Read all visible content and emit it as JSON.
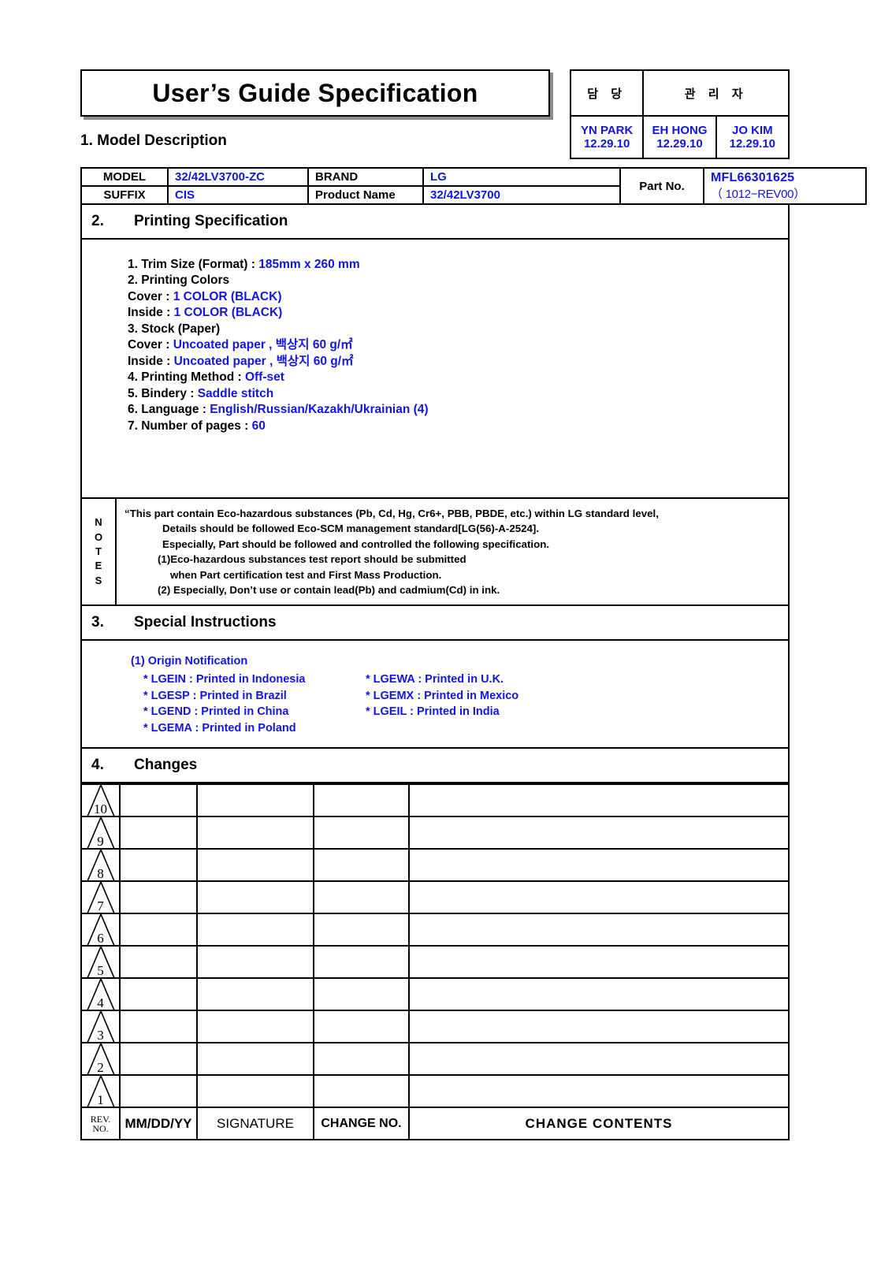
{
  "document": {
    "title": "User’s Guide Specification"
  },
  "approval": {
    "headers": [
      {
        "label": "담  당"
      },
      {
        "label": "관 리 자"
      }
    ],
    "signers": [
      {
        "name": "YN PARK",
        "date": "12.29.10"
      },
      {
        "name": "EH HONG",
        "date": "12.29.10"
      },
      {
        "name": "JO KIM",
        "date": "12.29.10"
      }
    ]
  },
  "section1": {
    "number": "1.",
    "title": "Model Description",
    "heading": "1. Model Description",
    "fields": {
      "model_label": "MODEL",
      "model_value": "32/42LV3700-ZC",
      "brand_label": "BRAND",
      "brand_value": "LG",
      "suffix_label": "SUFFIX",
      "suffix_value": "CIS",
      "product_name_label": "Product Name",
      "product_name_value": "32/42LV3700",
      "part_no_label": "Part No.",
      "part_no_value": "MFL66301625",
      "part_no_revision": "（ 1012−REV00）"
    }
  },
  "section2": {
    "number": "2.",
    "title": "Printing Specification",
    "items": [
      {
        "key": "1. Trim Size (Format) : ",
        "value": "185mm x 260 mm"
      },
      {
        "key": "2. Printing Colors",
        "value": ""
      },
      {
        "key": " Cover : ",
        "value": "1 COLOR (BLACK)"
      },
      {
        "key": " Inside : ",
        "value": "1 COLOR (BLACK)"
      },
      {
        "key": "3. Stock (Paper)",
        "value": ""
      },
      {
        "key": " Cover : ",
        "value": "Uncoated paper , 백상지 60 g/㎡"
      },
      {
        "key": " Inside : ",
        "value": "Uncoated paper , 백상지 60 g/㎡"
      },
      {
        "key": "4. Printing Method : ",
        "value": "Off-set"
      },
      {
        "key": "5. Bindery  : ",
        "value": "Saddle stitch"
      },
      {
        "key": "6. Language : ",
        "value": "English/Russian/Kazakh/Ukrainian (4)"
      },
      {
        "key": "7. Number of pages : ",
        "value": "60"
      }
    ]
  },
  "notes": {
    "label_letters": [
      "N",
      "O",
      "T",
      "E",
      "S"
    ],
    "lines": [
      "“This part contain Eco-hazardous substances (Pb, Cd, Hg, Cr6+, PBB, PBDE, etc.) within LG standard level,",
      "Details should be followed Eco-SCM management standard[LG(56)-A-2524].",
      "Especially, Part should be followed and controlled the following specification.",
      "(1)Eco-hazardous substances test report should be submitted",
      "when  Part certification test and First Mass Production.",
      "(2) Especially, Don’t use or contain lead(Pb) and cadmium(Cd) in ink."
    ]
  },
  "section3": {
    "number": "3.",
    "title": "Special Instructions",
    "origin_title": "(1) Origin Notification",
    "origins": [
      {
        "left": "* LGEIN : Printed in Indonesia",
        "right": "* LGEWA : Printed in U.K."
      },
      {
        "left": "* LGESP : Printed in Brazil",
        "right": "* LGEMX : Printed in Mexico"
      },
      {
        "left": "* LGEND : Printed in China",
        "right": " * LGEIL : Printed in India"
      },
      {
        "left": "* LGEMA : Printed in Poland",
        "right": ""
      }
    ]
  },
  "section4": {
    "number": "4.",
    "title": "Changes",
    "rows": [
      {
        "rev": "10",
        "date": "",
        "signature": "",
        "change_no": "",
        "change_contents": ""
      },
      {
        "rev": "9",
        "date": "",
        "signature": "",
        "change_no": "",
        "change_contents": ""
      },
      {
        "rev": "8",
        "date": "",
        "signature": "",
        "change_no": "",
        "change_contents": ""
      },
      {
        "rev": "7",
        "date": "",
        "signature": "",
        "change_no": "",
        "change_contents": ""
      },
      {
        "rev": "6",
        "date": "",
        "signature": "",
        "change_no": "",
        "change_contents": ""
      },
      {
        "rev": "5",
        "date": "",
        "signature": "",
        "change_no": "",
        "change_contents": ""
      },
      {
        "rev": "4",
        "date": "",
        "signature": "",
        "change_no": "",
        "change_contents": ""
      },
      {
        "rev": "3",
        "date": "",
        "signature": "",
        "change_no": "",
        "change_contents": ""
      },
      {
        "rev": "2",
        "date": "",
        "signature": "",
        "change_no": "",
        "change_contents": ""
      },
      {
        "rev": "1",
        "date": "",
        "signature": "",
        "change_no": "",
        "change_contents": ""
      }
    ],
    "footer": {
      "rev_no": "REV.\nNO.",
      "rev_no_line1": "REV.",
      "rev_no_line2": "NO.",
      "date": "MM/DD/YY",
      "signature": "SIGNATURE",
      "change_no": "CHANGE NO.",
      "change_contents": "CHANGE   CONTENTS"
    }
  },
  "colors": {
    "accent_blue": "#1414e0",
    "text_black": "#000000",
    "border": "#000000"
  }
}
